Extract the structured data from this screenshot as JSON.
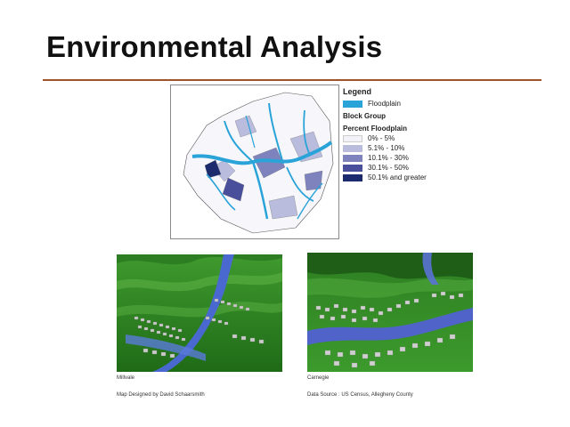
{
  "slide": {
    "title": "Environmental Analysis"
  },
  "legend": {
    "title": "Legend",
    "floodplain_label": "Floodplain",
    "block_group_label": "Block Group",
    "percent_label": "Percent Floodplain",
    "classes": [
      {
        "label": "0% - 5%",
        "color": "#f2f2f8"
      },
      {
        "label": "5.1% - 10%",
        "color": "#b9bcdc"
      },
      {
        "label": "10.1% - 30%",
        "color": "#7f83bd"
      },
      {
        "label": "30.1% - 50%",
        "color": "#4a4f9c"
      },
      {
        "label": "50.1% and greater",
        "color": "#1c2b6e"
      }
    ],
    "floodplain_color": "#2aa3d9"
  },
  "captions": {
    "left_place": "Millvale",
    "right_place": "Carnegie",
    "designer": "Map Designed by David Schaarsmith",
    "source": "Data Source : US Census, Allegheny County"
  }
}
